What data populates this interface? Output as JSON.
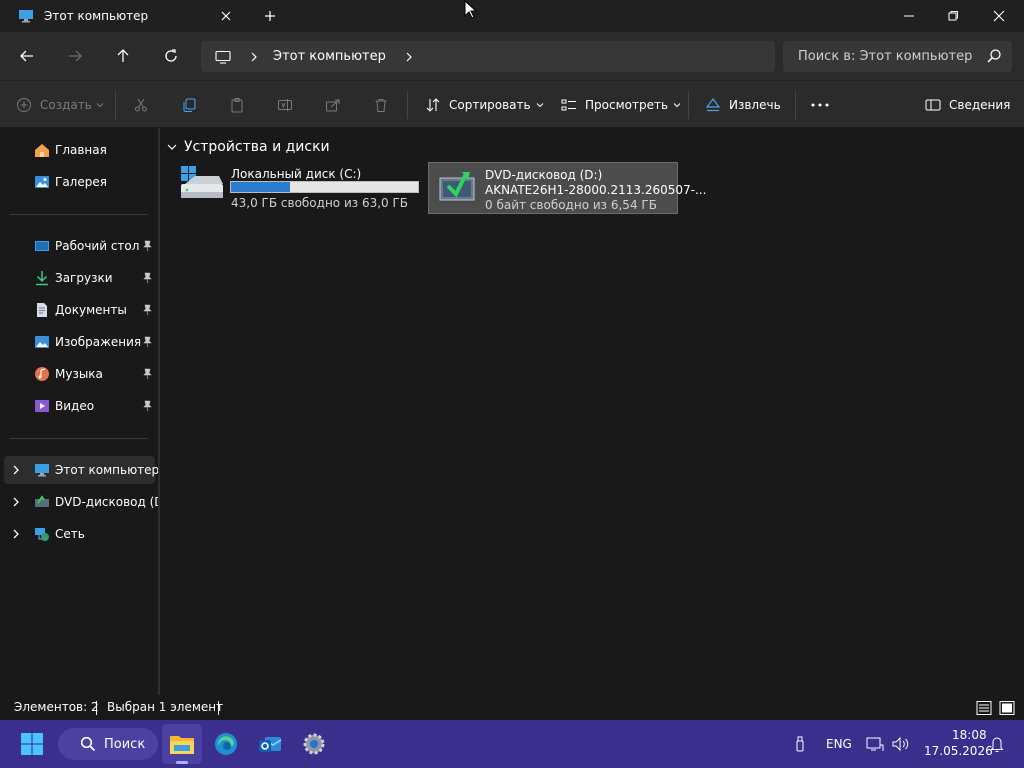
{
  "window": {
    "tab_title": "Этот компьютер"
  },
  "nav": {
    "breadcrumb": [
      "Этот компьютер"
    ],
    "search_placeholder": "Поиск в: Этот компьютер"
  },
  "commands": {
    "new_label": "Создать",
    "sort_label": "Сортировать",
    "view_label": "Просмотреть",
    "eject_label": "Извлечь",
    "details_label": "Сведения"
  },
  "sidebar": {
    "top": [
      {
        "label": "Главная",
        "icon": "home-icon"
      },
      {
        "label": "Галерея",
        "icon": "gallery-icon"
      }
    ],
    "pinned": [
      {
        "label": "Рабочий стол",
        "icon": "desktop-folder-icon"
      },
      {
        "label": "Загрузки",
        "icon": "downloads-icon"
      },
      {
        "label": "Документы",
        "icon": "documents-icon"
      },
      {
        "label": "Изображения",
        "icon": "pictures-icon"
      },
      {
        "label": "Музыка",
        "icon": "music-icon"
      },
      {
        "label": "Видео",
        "icon": "video-icon"
      }
    ],
    "tree": [
      {
        "label": "Этот компьютер",
        "icon": "this-pc-icon"
      },
      {
        "label": "DVD-дисковод (D:)",
        "icon": "dvd-icon"
      },
      {
        "label": "Сеть",
        "icon": "network-icon"
      }
    ]
  },
  "content": {
    "group_title": "Устройства и диски",
    "drives": [
      {
        "name": "Локальный диск (C:)",
        "free_text": "43,0 ГБ свободно из 63,0 ГБ",
        "used_fraction": 0.317
      },
      {
        "name": "DVD-дисковод (D:)",
        "label_line": "AKNATE26H1-28000.2113.260507-...",
        "free_text": "0 байт свободно из 6,54 ГБ"
      }
    ]
  },
  "status": {
    "items_count": "Элементов: 2",
    "selected_text": "Выбран 1 элемент"
  },
  "taskbar": {
    "search_label": "Поиск",
    "language": "ENG",
    "time": "18:08",
    "date": "17.05.2026"
  },
  "colors": {
    "accent": "#2b7bd0",
    "taskbar": "#3a2f8c"
  }
}
